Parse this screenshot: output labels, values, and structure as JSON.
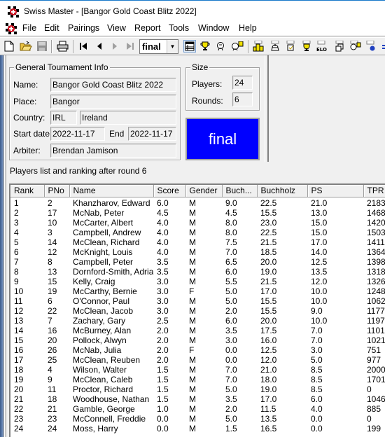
{
  "window": {
    "title": "Swiss Master - [Bangor Gold Coast Blitz 2022]"
  },
  "menu": [
    "File",
    "Edit",
    "Pairings",
    "View",
    "Report",
    "Tools",
    "Window",
    "Help"
  ],
  "toolbar": {
    "round_select_value": "final",
    "icons": [
      "new-file-icon",
      "open-folder-icon",
      "save-icon",
      "print-icon",
      "first-round-icon",
      "previous-round-icon",
      "next-round-icon",
      "last-round-icon",
      "players-list-icon",
      "trophy-icon",
      "player-head-icon",
      "player-numbered-icon",
      "podium-report-icon",
      "king-report-icon",
      "scroll-report-icon",
      "trophy-report-icon",
      "elo-report-icon",
      "copy-windows-icon",
      "player-pairing-icon",
      "globe-report-icon",
      "export-icon"
    ]
  },
  "general_info": {
    "legend": "General Tournament Info",
    "name_label": "Name:",
    "name": "Bangor Gold Coast Blitz 2022",
    "place_label": "Place:",
    "place": "Bangor",
    "country_label": "Country:",
    "country_code": "IRL",
    "country_name": "Ireland",
    "start_label": "Start date:",
    "start_date": "2022-11-17",
    "end_label": "End",
    "end_date": "2022-11-17",
    "arbiter_label": "Arbiter:",
    "arbiter": "Brendan Jamison"
  },
  "size": {
    "legend": "Size",
    "players_label": "Players:",
    "players": "24",
    "rounds_label": "Rounds:",
    "rounds": "6"
  },
  "status": {
    "text": "final",
    "color": "#0000ff"
  },
  "players_list": {
    "heading": "Players list and ranking after round 6",
    "columns": [
      "Rank",
      "PNo",
      "Name",
      "Score",
      "Gender",
      "Buch...",
      "Buchholz",
      "PS",
      "TPR ..."
    ],
    "rows": [
      [
        "1",
        "2",
        "Khanzharov, Edward",
        "6.0",
        "M",
        "9.0",
        "22.5",
        "21.0",
        "2183"
      ],
      [
        "2",
        "17",
        "McNab, Peter",
        "4.5",
        "M",
        "4.5",
        "15.5",
        "13.0",
        "1468"
      ],
      [
        "3",
        "10",
        "McCarter, Albert",
        "4.0",
        "M",
        "8.0",
        "23.0",
        "15.0",
        "1420"
      ],
      [
        "4",
        "3",
        "Campbell, Andrew",
        "4.0",
        "M",
        "8.0",
        "22.5",
        "15.0",
        "1503"
      ],
      [
        "5",
        "14",
        "McClean, Richard",
        "4.0",
        "M",
        "7.5",
        "21.5",
        "17.0",
        "1411"
      ],
      [
        "6",
        "12",
        "McKnight, Louis",
        "4.0",
        "M",
        "7.0",
        "18.5",
        "14.0",
        "1364"
      ],
      [
        "7",
        "8",
        "Campbell, Peter",
        "3.5",
        "M",
        "6.5",
        "20.0",
        "12.5",
        "1398"
      ],
      [
        "8",
        "13",
        "Dornford-Smith, Adrian",
        "3.5",
        "M",
        "6.0",
        "19.0",
        "13.5",
        "1318"
      ],
      [
        "9",
        "15",
        "Kelly, Craig",
        "3.0",
        "M",
        "5.5",
        "21.5",
        "12.0",
        "1326"
      ],
      [
        "10",
        "19",
        "McCarthy, Bernie",
        "3.0",
        "F",
        "5.0",
        "17.0",
        "10.0",
        "1248"
      ],
      [
        "11",
        "6",
        "O'Connor, Paul",
        "3.0",
        "M",
        "5.0",
        "15.5",
        "10.0",
        "1062"
      ],
      [
        "12",
        "22",
        "McClean, Jacob",
        "3.0",
        "M",
        "2.0",
        "15.5",
        "9.0",
        "1177"
      ],
      [
        "13",
        "7",
        "Zachary, Gary",
        "2.5",
        "M",
        "6.0",
        "20.0",
        "10.0",
        "1197"
      ],
      [
        "14",
        "16",
        "McBurney, Alan",
        "2.0",
        "M",
        "3.5",
        "17.5",
        "7.0",
        "1101"
      ],
      [
        "15",
        "20",
        "Pollock, Alwyn",
        "2.0",
        "M",
        "3.0",
        "16.0",
        "7.0",
        "1021"
      ],
      [
        "16",
        "26",
        "McNab, Julia",
        "2.0",
        "F",
        "0.0",
        "12.5",
        "3.0",
        "751"
      ],
      [
        "17",
        "25",
        "McClean, Reuben",
        "2.0",
        "M",
        "0.0",
        "12.0",
        "5.0",
        "977"
      ],
      [
        "18",
        "4",
        "Wilson, Walter",
        "1.5",
        "M",
        "7.0",
        "21.0",
        "8.5",
        "2000"
      ],
      [
        "19",
        "9",
        "McClean, Caleb",
        "1.5",
        "M",
        "7.0",
        "18.0",
        "8.5",
        "1701"
      ],
      [
        "20",
        "11",
        "Proctor, Richard",
        "1.5",
        "M",
        "5.0",
        "19.0",
        "8.5",
        "0"
      ],
      [
        "21",
        "18",
        "Woodhouse, Nathan",
        "1.5",
        "M",
        "3.5",
        "17.0",
        "6.0",
        "1046"
      ],
      [
        "22",
        "21",
        "Gamble, George",
        "1.0",
        "M",
        "2.0",
        "11.5",
        "4.0",
        "885"
      ],
      [
        "23",
        "23",
        "McConnell, Freddie",
        "0.0",
        "M",
        "5.0",
        "13.5",
        "0.0",
        "0"
      ],
      [
        "24",
        "24",
        "Moss, Harry",
        "0.0",
        "M",
        "1.5",
        "16.5",
        "0.0",
        "199"
      ]
    ]
  }
}
